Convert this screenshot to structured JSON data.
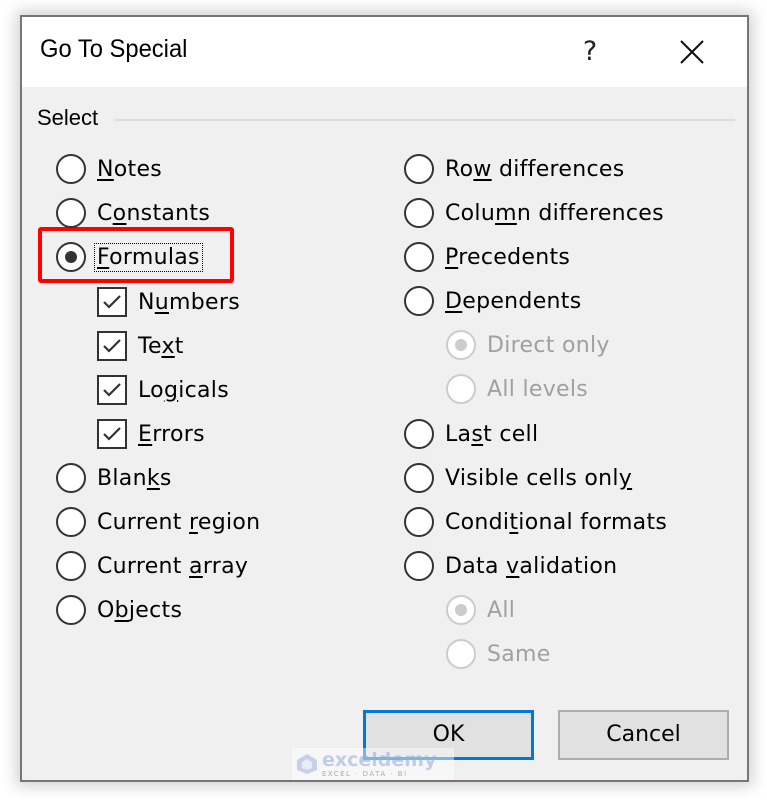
{
  "dialog": {
    "title": "Go To Special",
    "help_label": "?",
    "close_icon": "close-icon"
  },
  "group": {
    "label": "Select"
  },
  "left_options": [
    {
      "id": "notes",
      "pre": "",
      "mn": "N",
      "post": "otes",
      "type": "radio",
      "checked": false,
      "disabled": false
    },
    {
      "id": "constants",
      "pre": "C",
      "mn": "o",
      "post": "nstants",
      "type": "radio",
      "checked": false,
      "disabled": false
    },
    {
      "id": "formulas",
      "pre": "",
      "mn": "F",
      "post": "ormulas",
      "type": "radio",
      "checked": true,
      "disabled": false,
      "focused": true,
      "highlighted": true
    },
    {
      "id": "numbers",
      "pre": "N",
      "mn": "u",
      "post": "mbers",
      "type": "checkbox",
      "checked": true,
      "disabled": false
    },
    {
      "id": "text",
      "pre": "Te",
      "mn": "x",
      "post": "t",
      "type": "checkbox",
      "checked": true,
      "disabled": false
    },
    {
      "id": "logicals",
      "pre": "Lo",
      "mn": "g",
      "post": "icals",
      "type": "checkbox",
      "checked": true,
      "disabled": false
    },
    {
      "id": "errors",
      "pre": "",
      "mn": "E",
      "post": "rrors",
      "type": "checkbox",
      "checked": true,
      "disabled": false
    },
    {
      "id": "blanks",
      "pre": "Blan",
      "mn": "k",
      "post": "s",
      "type": "radio",
      "checked": false,
      "disabled": false
    },
    {
      "id": "current-region",
      "pre": "Current ",
      "mn": "r",
      "post": "egion",
      "type": "radio",
      "checked": false,
      "disabled": false
    },
    {
      "id": "current-array",
      "pre": "Current ",
      "mn": "a",
      "post": "rray",
      "type": "radio",
      "checked": false,
      "disabled": false
    },
    {
      "id": "objects",
      "pre": "O",
      "mn": "b",
      "post": "jects",
      "type": "radio",
      "checked": false,
      "disabled": false
    }
  ],
  "right_options": [
    {
      "id": "row-differences",
      "pre": "Ro",
      "mn": "w",
      "post": " differences",
      "type": "radio",
      "checked": false,
      "disabled": false
    },
    {
      "id": "column-differences",
      "pre": "Colu",
      "mn": "m",
      "post": "n differences",
      "type": "radio",
      "checked": false,
      "disabled": false
    },
    {
      "id": "precedents",
      "pre": "",
      "mn": "P",
      "post": "recedents",
      "type": "radio",
      "checked": false,
      "disabled": false
    },
    {
      "id": "dependents",
      "pre": "",
      "mn": "D",
      "post": "ependents",
      "type": "radio",
      "checked": false,
      "disabled": false
    },
    {
      "id": "direct-only",
      "pre": "Direct only",
      "mn": "",
      "post": "",
      "type": "radio",
      "checked": true,
      "disabled": true
    },
    {
      "id": "all-levels",
      "pre": "All levels",
      "mn": "",
      "post": "",
      "type": "radio",
      "checked": false,
      "disabled": true
    },
    {
      "id": "last-cell",
      "pre": "La",
      "mn": "s",
      "post": "t cell",
      "type": "radio",
      "checked": false,
      "disabled": false
    },
    {
      "id": "visible-cells-only",
      "pre": "Visible cells onl",
      "mn": "y",
      "post": "",
      "type": "radio",
      "checked": false,
      "disabled": false
    },
    {
      "id": "conditional-formats",
      "pre": "Condi",
      "mn": "t",
      "post": "ional formats",
      "type": "radio",
      "checked": false,
      "disabled": false
    },
    {
      "id": "data-validation",
      "pre": "Data ",
      "mn": "v",
      "post": "alidation",
      "type": "radio",
      "checked": false,
      "disabled": false
    },
    {
      "id": "validation-all",
      "pre": "All",
      "mn": "",
      "post": "",
      "type": "radio",
      "checked": true,
      "disabled": true
    },
    {
      "id": "validation-same",
      "pre": "Same",
      "mn": "",
      "post": "",
      "type": "radio",
      "checked": false,
      "disabled": true
    }
  ],
  "buttons": {
    "ok_label": "OK",
    "cancel_label": "Cancel"
  },
  "watermark": {
    "main": "exceldemy",
    "sub": "EXCEL · DATA · BI"
  },
  "colors": {
    "highlight": "#ff0000",
    "default_button_border": "#0078d7",
    "disabled_text": "#a0a0a0"
  }
}
